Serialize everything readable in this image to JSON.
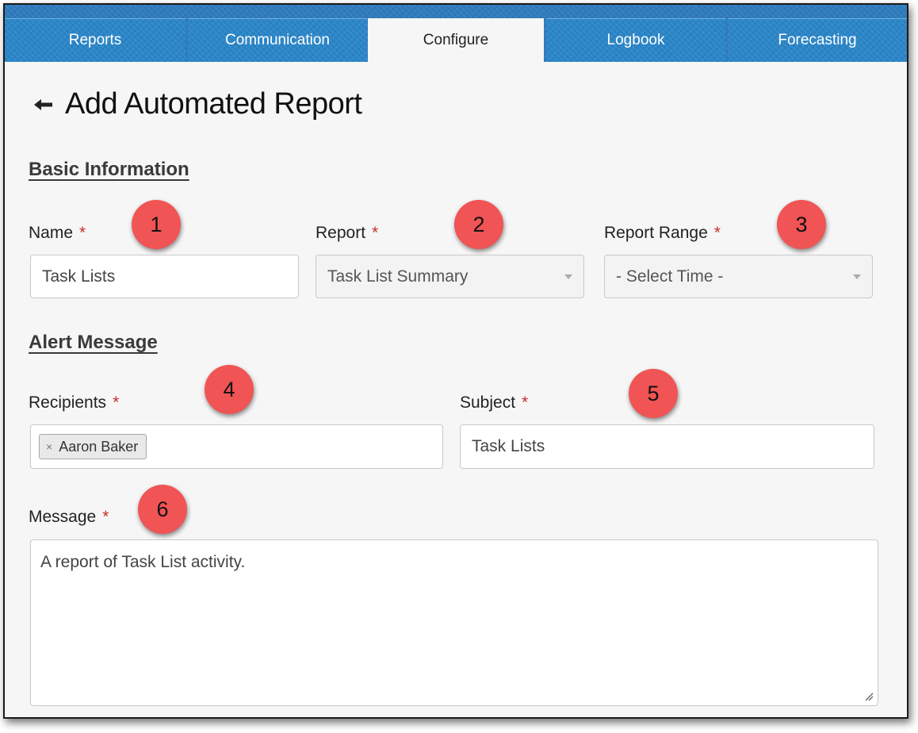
{
  "tabs": [
    {
      "label": "Reports",
      "active": false
    },
    {
      "label": "Communication",
      "active": false
    },
    {
      "label": "Configure",
      "active": true
    },
    {
      "label": "Logbook",
      "active": false
    },
    {
      "label": "Forecasting",
      "active": false
    }
  ],
  "page": {
    "title": "Add Automated Report",
    "back_icon": "arrow-left-icon"
  },
  "required_marker": "*",
  "basic_info": {
    "heading": "Basic Information",
    "name": {
      "label": "Name",
      "value": "Task Lists",
      "badge": "1"
    },
    "report": {
      "label": "Report",
      "value": "Task List Summary",
      "badge": "2"
    },
    "report_range": {
      "label": "Report Range",
      "value": "- Select Time -",
      "badge": "3"
    }
  },
  "alert_message": {
    "heading": "Alert Message",
    "recipients": {
      "label": "Recipients",
      "tags": [
        "Aaron Baker"
      ],
      "tag_remove_glyph": "×",
      "badge": "4"
    },
    "subject": {
      "label": "Subject",
      "value": "Task Lists",
      "badge": "5"
    },
    "message": {
      "label": "Message",
      "value": "A report of Task List activity.",
      "badge": "6"
    }
  },
  "colors": {
    "tab_blue": "#2a86c9",
    "required_red": "#c9302c",
    "badge_red": "#f05454"
  }
}
